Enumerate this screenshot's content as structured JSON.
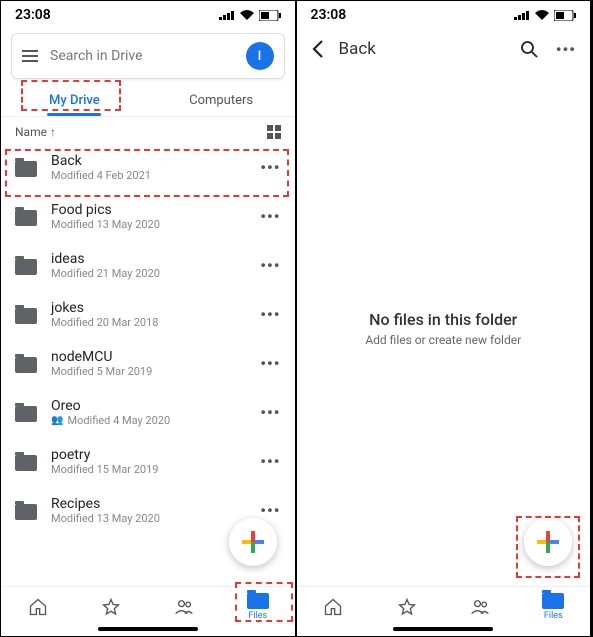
{
  "status": {
    "time": "23:08"
  },
  "left": {
    "search_placeholder": "Search in Drive",
    "avatar_letter": "I",
    "tabs": {
      "my_drive": "My Drive",
      "computers": "Computers"
    },
    "sort_label": "Name",
    "files": [
      {
        "name": "Back",
        "sub": "Modified 4 Feb 2021",
        "shared": false
      },
      {
        "name": "Food pics",
        "sub": "Modified 13 May 2020",
        "shared": false
      },
      {
        "name": "ideas",
        "sub": "Modified 21 May 2020",
        "shared": false
      },
      {
        "name": "jokes",
        "sub": "Modified 20 Mar 2018",
        "shared": false
      },
      {
        "name": "nodeMCU",
        "sub": "Modified 5 Mar 2019",
        "shared": false
      },
      {
        "name": "Oreo",
        "sub": "Modified 4 May 2020",
        "shared": true
      },
      {
        "name": "poetry",
        "sub": "Modified 15 Mar 2019",
        "shared": false
      },
      {
        "name": "Recipes",
        "sub": "Modified 13 May 2020",
        "shared": false
      }
    ],
    "nav": {
      "files_label": "Files"
    }
  },
  "right": {
    "header_title": "Back",
    "empty_title": "No files in this folder",
    "empty_sub": "Add files or create new folder",
    "nav": {
      "files_label": "Files"
    }
  }
}
